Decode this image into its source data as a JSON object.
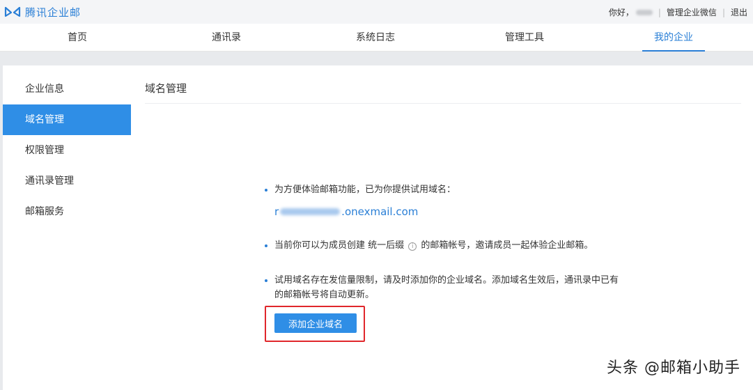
{
  "header": {
    "logo_text": "腾讯企业邮",
    "greeting": "你好，",
    "manage_wechat": "管理企业微信",
    "logout": "退出"
  },
  "nav": {
    "tabs": [
      {
        "label": "首页",
        "active": false
      },
      {
        "label": "通讯录",
        "active": false
      },
      {
        "label": "系统日志",
        "active": false
      },
      {
        "label": "管理工具",
        "active": false
      },
      {
        "label": "我的企业",
        "active": true
      }
    ]
  },
  "sidebar": {
    "items": [
      {
        "label": "企业信息",
        "active": false
      },
      {
        "label": "域名管理",
        "active": true
      },
      {
        "label": "权限管理",
        "active": false
      },
      {
        "label": "通讯录管理",
        "active": false
      },
      {
        "label": "邮箱服务",
        "active": false
      }
    ]
  },
  "main": {
    "title": "域名管理",
    "notice1": "为方便体验邮箱功能，已为你提供试用域名：",
    "domain_prefix": "r",
    "domain_suffix": ".onexmail.com",
    "notice2_a": "当前你可以为成员创建  统一后缀 ",
    "notice2_icon": "i",
    "notice2_b": " 的邮箱帐号，邀请成员一起体验企业邮箱。",
    "notice3": "试用域名存在发信量限制，请及时添加你的企业域名。添加域名生效后，通讯录中已有的邮箱帐号将自动更新。",
    "add_button": "添加企业域名"
  },
  "watermark": "头条 @邮箱小助手",
  "colors": {
    "accent": "#2f8ee6",
    "link": "#2a7fd6",
    "highlight": "#e0262b"
  }
}
